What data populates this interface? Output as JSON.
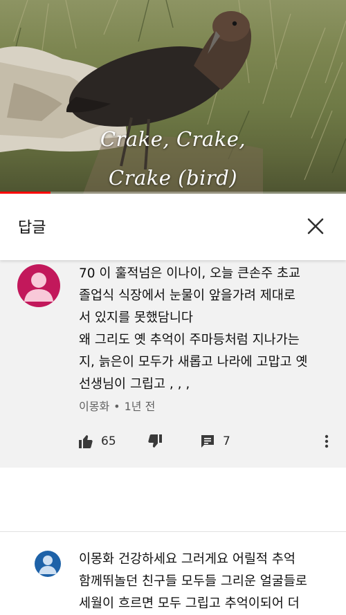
{
  "video": {
    "caption_line1": "Crake, Crake,",
    "caption_line2": "Crake (bird)",
    "progress": 0.145,
    "progress_color": "#ff0000"
  },
  "replies_panel": {
    "title": "답글",
    "close_icon": "close-icon"
  },
  "parent_comment": {
    "avatar_color": "#c2185b",
    "text": "70 이 훌적넘은 이나이,  오늘 큰손주 초교\n졸업식 식장에서 눈물이 앞을가려  제대로\n서 있지를  못했담니다\n왜 그리도 옛 추억이 주마등처럼 지나가는\n지, 늙은이 모두가 새롭고 나라에 고맙고 옛\n선생님이 그립고 , , ,",
    "author": "이몽화",
    "separator": "•",
    "time": "1년 전",
    "like_count": "65",
    "reply_count": "7",
    "icons": [
      "thumb-up-icon",
      "thumb-down-icon",
      "comment-icon",
      "more-vert-icon"
    ]
  },
  "child_reply": {
    "avatar_color": "#1e62a8",
    "text": "이몽화 건강하세요 그러게요 어릴적 추억\n함께뛰놀던 친구들 모두들 그리운 얼굴들로\n세월이 흐르면 모두 그립고 추억이되어 더"
  }
}
